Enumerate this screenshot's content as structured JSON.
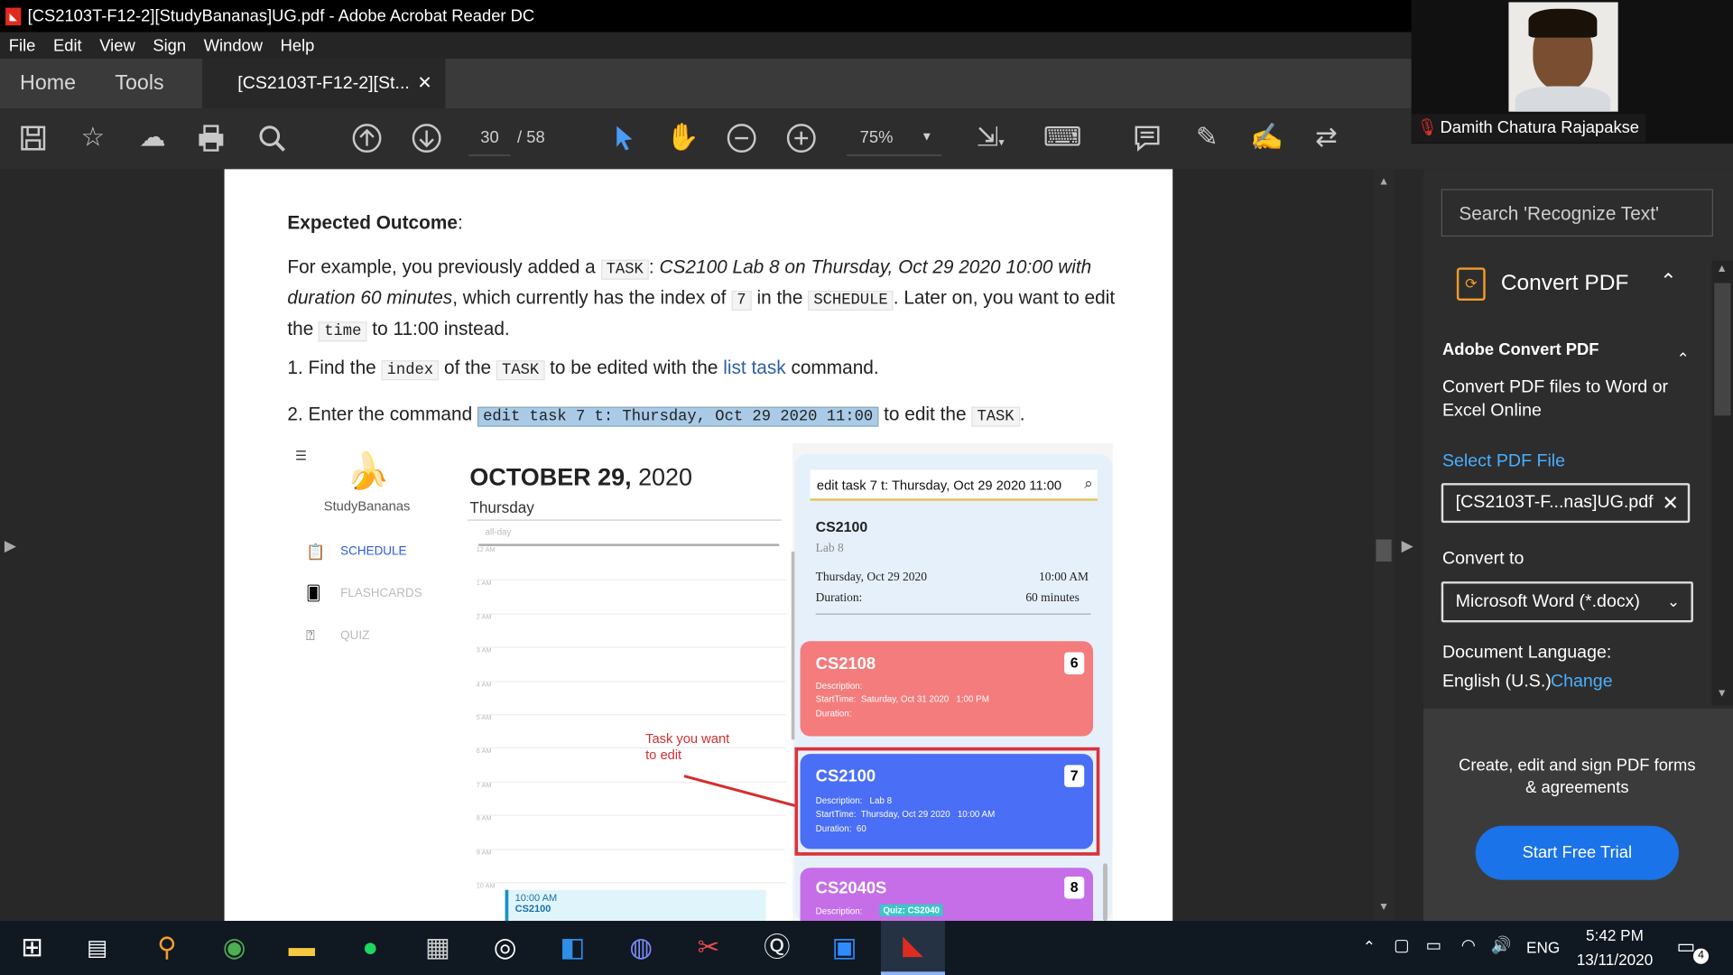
{
  "window": {
    "title": "[CS2103T-F12-2][StudyBananas]UG.pdf - Adobe Acrobat Reader DC"
  },
  "menu": [
    "File",
    "Edit",
    "View",
    "Sign",
    "Window",
    "Help"
  ],
  "tabs": {
    "home": "Home",
    "tools": "Tools",
    "document": "[CS2103T-F12-2][St..."
  },
  "toolbar": {
    "page_current": "30",
    "page_total": "/ 58",
    "zoom": "75%"
  },
  "document": {
    "heading": "Expected Outcome",
    "heading_suffix": ":",
    "p1": {
      "a": "For example, you previously added a",
      "task_code": "TASK",
      "b": ":",
      "italic": "CS2100 Lab 8 on Thursday, Oct 29 2020 10:00 with duration 60 minutes",
      "c": ", which currently has the index of",
      "index_code": "7",
      "d": "in the",
      "schedule_code": "SCHEDULE",
      "e": ". Later on, you want to edit the",
      "time_code": "time",
      "f": "to 11:00 instead."
    },
    "step1": {
      "a": "1. Find the",
      "index_code": "index",
      "b": "of the",
      "task_code": "TASK",
      "c": "to be edited with the",
      "link": "list task",
      "d": "command."
    },
    "step2": {
      "a": "2. Enter the command",
      "command": "edit task 7 t: Thursday, Oct 29 2020 11:00",
      "b": "to edit the",
      "task_code": "TASK",
      "c": "."
    }
  },
  "app": {
    "name": "StudyBananas",
    "nav": [
      "SCHEDULE",
      "FLASHCARDS",
      "QUIZ"
    ],
    "date_bold": "OCTOBER 29,",
    "date_year": "2020",
    "weekday": "Thursday",
    "allday": "all-day",
    "hours": [
      "12 AM",
      "1 AM",
      "2 AM",
      "3 AM",
      "4 AM",
      "5 AM",
      "6 AM",
      "7 AM",
      "8 AM",
      "9 AM",
      "10 AM"
    ],
    "event_time": "10:00 AM",
    "event_title": "CS2100",
    "command_input": "edit task 7 t: Thursday, Oct 29 2020 11:00",
    "detail": {
      "title": "CS2100",
      "sub": "Lab 8",
      "date": "Thursday, Oct 29 2020",
      "time": "10:00 AM",
      "duration_label": "Duration:",
      "duration": "60 minutes"
    },
    "cards": [
      {
        "title": "CS2108",
        "num": "6",
        "desc": "Description:",
        "start": "StartTime:  Saturday, Oct 31 2020   1:00 PM",
        "dur": "Duration:",
        "color": "#f47c7c"
      },
      {
        "title": "CS2100",
        "num": "7",
        "desc": "Description:   Lab 8",
        "start": "StartTime:  Thursday, Oct 29 2020   10:00 AM",
        "dur": "Duration:  60",
        "color": "#4a6ef5"
      },
      {
        "title": "CS2040S",
        "num": "8",
        "desc": "Description:",
        "tag": "Quiz: CS2040",
        "color": "#c56ee8"
      }
    ],
    "tooltip": "editTask1",
    "annotation": "Task you want\nto edit",
    "annotation_color": "#d32f2f"
  },
  "right_panel": {
    "search": "Search 'Recognize Text'",
    "convert_header": "Convert PDF",
    "adobe_title": "Adobe Convert PDF",
    "adobe_desc": "Convert PDF files to Word or Excel Online",
    "select_label": "Select PDF File",
    "file": "[CS2103T-F...nas]UG.pdf",
    "convert_to": "Convert to",
    "format": "Microsoft Word (*.docx)",
    "lang_label": "Document Language:",
    "lang": "English (U.S.)",
    "change": "Change",
    "promo": "Create, edit and sign PDF forms & agreements",
    "trial": "Start Free Trial"
  },
  "video": {
    "name": "Damith Chatura Rajapakse"
  },
  "taskbar": {
    "lang": "ENG",
    "time": "5:42 PM",
    "date": "13/11/2020",
    "notif": "4"
  }
}
